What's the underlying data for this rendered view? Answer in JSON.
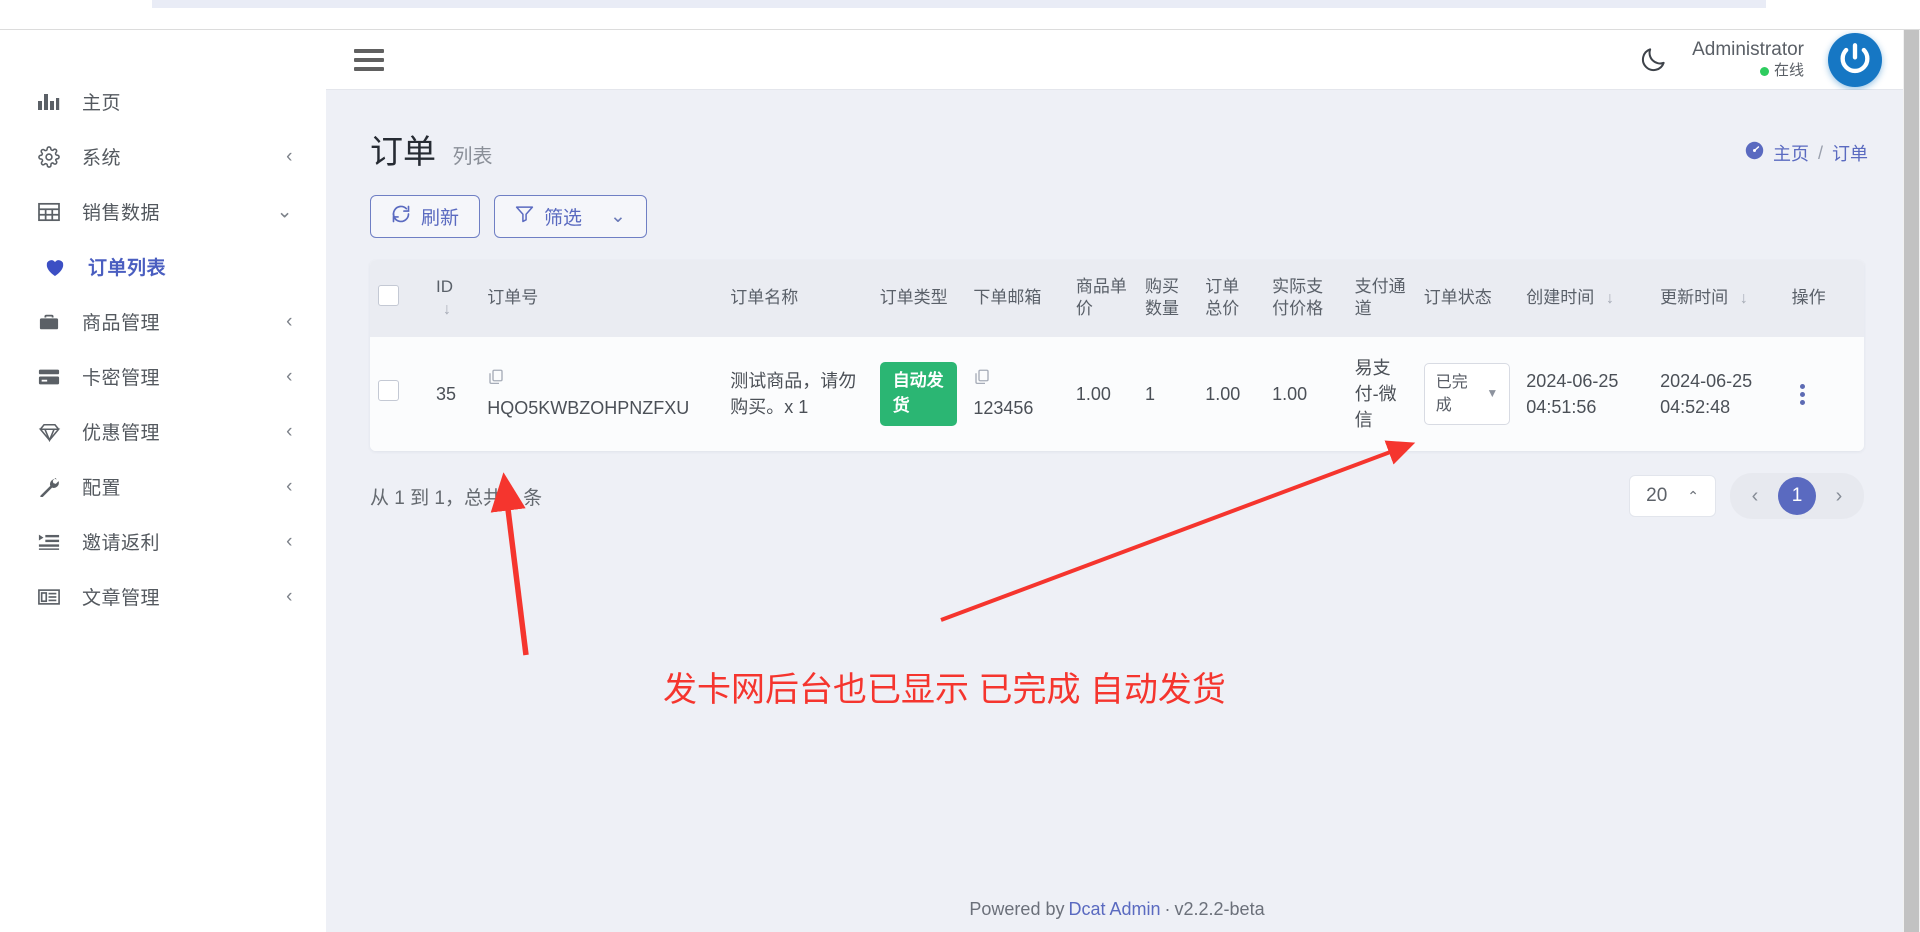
{
  "browser": {
    "tab_stub": ""
  },
  "sidebar": {
    "items": [
      {
        "label": "主页",
        "icon": "bar-chart-icon",
        "arrow": "",
        "active": false
      },
      {
        "label": "系统",
        "icon": "gear-icon",
        "arrow": "‹",
        "active": false
      },
      {
        "label": "销售数据",
        "icon": "table-grid-icon",
        "arrow": "⌄",
        "active": false
      },
      {
        "label": "订单列表",
        "icon": "heart-icon",
        "arrow": "",
        "active": true
      },
      {
        "label": "商品管理",
        "icon": "briefcase-icon",
        "arrow": "‹",
        "active": false
      },
      {
        "label": "卡密管理",
        "icon": "credit-card-icon",
        "arrow": "‹",
        "active": false
      },
      {
        "label": "优惠管理",
        "icon": "diamond-icon",
        "arrow": "‹",
        "active": false
      },
      {
        "label": "配置",
        "icon": "wrench-icon",
        "arrow": "‹",
        "active": false
      },
      {
        "label": "邀请返利",
        "icon": "list-indent-icon",
        "arrow": "‹",
        "active": false
      },
      {
        "label": "文章管理",
        "icon": "article-icon",
        "arrow": "‹",
        "active": false
      }
    ]
  },
  "topbar": {
    "menu_icon": "hamburger-icon",
    "theme_icon": "moon-icon",
    "user_name": "Administrator",
    "user_status": "在线",
    "avatar_icon": "power-logo-icon",
    "status_color": "#2ecc5f",
    "avatar_color": "#1677c4"
  },
  "page": {
    "title": "订单",
    "subtitle": "列表",
    "breadcrumb": {
      "icon": "dashboard-icon",
      "home": "主页",
      "sep": "/",
      "current": "订单"
    }
  },
  "toolbar": {
    "refresh_icon": "refresh-icon",
    "refresh_label": "刷新",
    "filter_icon": "funnel-icon",
    "filter_label": "筛选",
    "filter_chevron": "⌄"
  },
  "table": {
    "select_all_icon": "checkbox-icon",
    "columns": [
      {
        "label": "ID",
        "sort": "↓"
      },
      {
        "label": "订单号",
        "sort": ""
      },
      {
        "label": "订单名称",
        "sort": ""
      },
      {
        "label": "订单类型",
        "sort": ""
      },
      {
        "label": "下单邮箱",
        "sort": ""
      },
      {
        "label": "商品单价",
        "sort": ""
      },
      {
        "label": "购买数量",
        "sort": ""
      },
      {
        "label": "订单总价",
        "sort": ""
      },
      {
        "label": "实际支付价格",
        "sort": ""
      },
      {
        "label": "支付通道",
        "sort": ""
      },
      {
        "label": "订单状态",
        "sort": ""
      },
      {
        "label": "创建时间",
        "sort": "↓"
      },
      {
        "label": "更新时间",
        "sort": "↓"
      },
      {
        "label": "操作",
        "sort": ""
      }
    ],
    "rows": [
      {
        "id": "35",
        "order_no": "HQO5KWBZOHPNZFXU",
        "order_name": "测试商品，请勿购买。x 1",
        "order_type": "自动发货",
        "order_type_color": "#2bb673",
        "email": "123456",
        "unit_price": "1.00",
        "quantity": "1",
        "total_price": "1.00",
        "paid_price": "1.00",
        "pay_channel": "易支付-微信",
        "status": "已完成",
        "created_at": "2024-06-25 04:51:56",
        "updated_at": "2024-06-25 04:52:48",
        "action_icon": "vertical-dots-icon",
        "copy_icon": "copy-icon"
      }
    ]
  },
  "pagination": {
    "summary": "从 1 到 1，总共 1 条",
    "summary_from": "1",
    "summary_to": "1",
    "summary_total": "1",
    "page_size": "20",
    "page_size_caret": "⌃",
    "prev": "‹",
    "next": "›",
    "current_page": "1"
  },
  "annotation": {
    "text": "发卡网后台也已显示  已完成  自动发货",
    "color": "#f5352e"
  },
  "footer": {
    "prefix": "Powered by",
    "brand": "Dcat Admin",
    "dot": "·",
    "version": "v2.2.2-beta"
  }
}
